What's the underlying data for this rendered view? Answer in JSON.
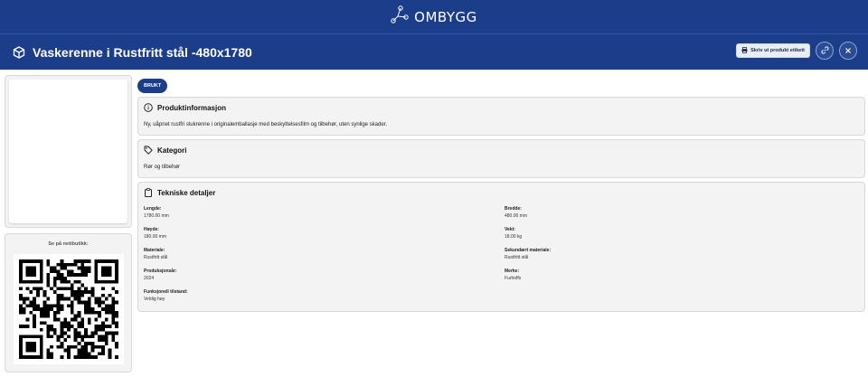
{
  "brand": {
    "name": "OMBYGG",
    "logo_icon": "molecule-icon"
  },
  "header": {
    "title": "Vaskerenne i Rustfritt stål -480x1780",
    "title_icon": "box-icon",
    "print_label": "Skriv ut produkt etikett",
    "link_icon": "link-icon",
    "close_icon": "close-icon"
  },
  "sidebar": {
    "qr_label": "Se på nettbutikk:"
  },
  "badge": "BRUKT",
  "product_info": {
    "title": "Produktinformasjon",
    "icon": "info-icon",
    "text": "Ny, uåpnet rustfri slukrenne i originalemballasje med beskyttelsesfilm og tilbehør, uten synlige skader."
  },
  "category": {
    "title": "Kategori",
    "icon": "tag-icon",
    "text": "Rør og tilbehør"
  },
  "technical": {
    "title": "Tekniske detaljer",
    "icon": "clipboard-icon",
    "items": [
      {
        "label": "Lengde:",
        "value": "1780.00 mm"
      },
      {
        "label": "Bredde:",
        "value": "480.00 mm"
      },
      {
        "label": "Høyde:",
        "value": "180.00 mm"
      },
      {
        "label": "Vekt:",
        "value": "18.00 kg"
      },
      {
        "label": "Materiale:",
        "value": "Rustfritt stål"
      },
      {
        "label": "Sekundært materiale:",
        "value": "Rustfritt stål"
      },
      {
        "label": "Produksjonsår:",
        "value": "2024"
      },
      {
        "label": "Merke:",
        "value": "Furhoffs"
      },
      {
        "label": "Funksjonell tilstand:",
        "value": "Veldig høy"
      }
    ]
  },
  "colors": {
    "primary": "#1c3e8a",
    "card_bg": "#f3f3f3"
  }
}
